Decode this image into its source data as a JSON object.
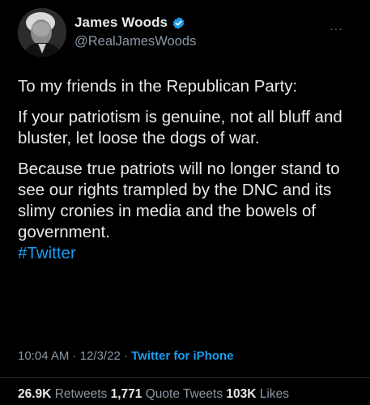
{
  "author": {
    "display_name": "James Woods",
    "handle": "@RealJamesWoods",
    "verified": true,
    "verified_color": "#1d9bf0"
  },
  "menu_icon": "more-dots-icon",
  "tweet": {
    "paragraphs": [
      "To my friends in the Republican Party:",
      "If your patriotism is genuine, not all bluff and bluster, let loose the dogs of war.",
      "Because true patriots will no longer stand to see our rights trampled by the DNC and its slimy cronies in media and the bowels of government."
    ],
    "hashtag": "#Twitter"
  },
  "meta": {
    "time": "10:04 AM",
    "separator": "·",
    "date": "12/3/22",
    "source": "Twitter for iPhone"
  },
  "stats": {
    "retweets_count": "26.9K",
    "retweets_label": "Retweets",
    "quotes_count": "1,771",
    "quotes_label": "Quote Tweets",
    "likes_count": "103K",
    "likes_label": "Likes"
  },
  "colors": {
    "background": "#000000",
    "primary_text": "#e7e9ea",
    "secondary_text": "#8b98a5",
    "link": "#1d9bf0"
  }
}
